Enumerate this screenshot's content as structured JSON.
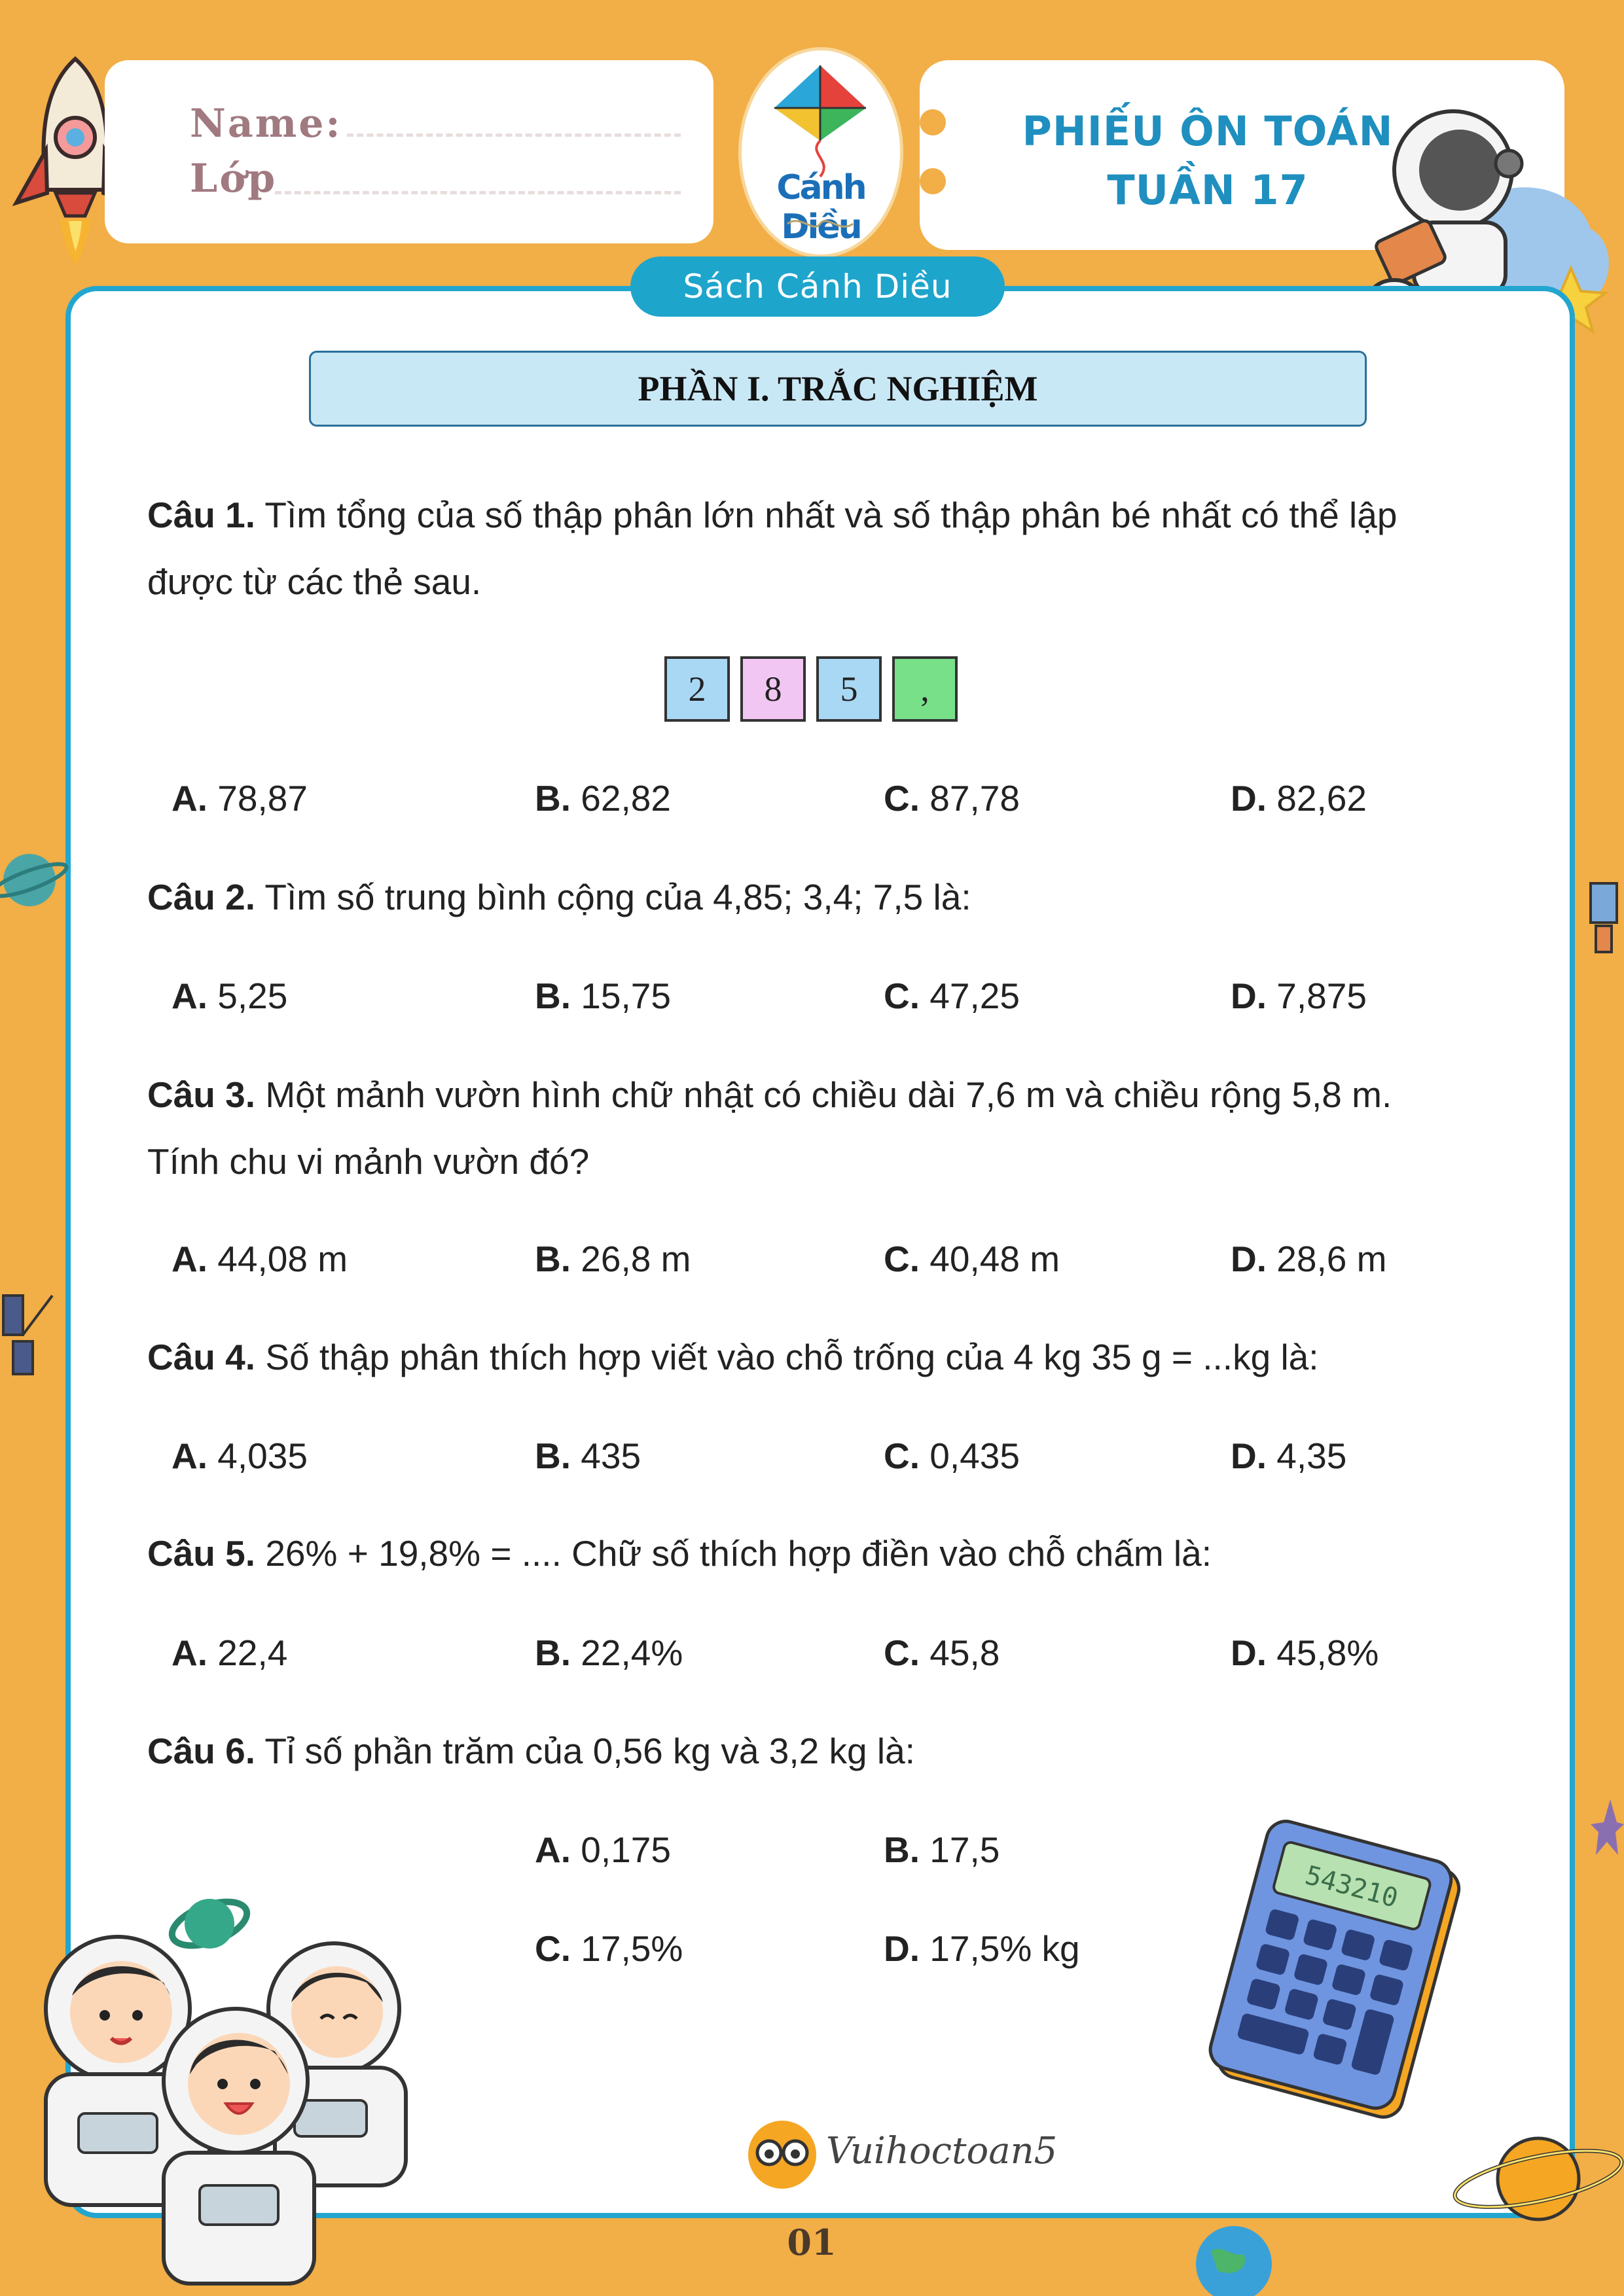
{
  "header": {
    "name_label": "Name:",
    "class_label": "Lớp",
    "title_line1": "PHIẾU ÔN TOÁN",
    "title_line2": "TUẦN 17",
    "kite_brand": "Cánh Diều",
    "book_pill": "Sách Cánh Diều"
  },
  "section": {
    "heading": "PHẦN I. TRẮC NGHIỆM"
  },
  "questions": [
    {
      "label": "Câu 1.",
      "text_line1": " Tìm tổng của số thập phân lớn nhất và số thập phân bé nhất có thể lập",
      "text_line2": "được từ các thẻ sau.",
      "cards": [
        "2",
        "8",
        "5",
        ","
      ],
      "options": [
        {
          "letter": "A.",
          "text": " 78,87"
        },
        {
          "letter": "B.",
          "text": " 62,82"
        },
        {
          "letter": "C.",
          "text": " 87,78"
        },
        {
          "letter": "D.",
          "text": " 82,62"
        }
      ]
    },
    {
      "label": "Câu 2.",
      "text_line1": " Tìm số trung bình cộng của 4,85; 3,4; 7,5 là:",
      "options": [
        {
          "letter": "A.",
          "text": " 5,25"
        },
        {
          "letter": "B.",
          "text": " 15,75"
        },
        {
          "letter": "C.",
          "text": " 47,25"
        },
        {
          "letter": "D.",
          "text": " 7,875"
        }
      ]
    },
    {
      "label": "Câu 3.",
      "text_line1": " Một mảnh vườn hình chữ nhật có chiều dài 7,6 m và chiều rộng 5,8 m.",
      "text_line2": "Tính chu vi mảnh vườn đó?",
      "options": [
        {
          "letter": "A.",
          "text": " 44,08 m"
        },
        {
          "letter": "B.",
          "text": " 26,8 m"
        },
        {
          "letter": "C.",
          "text": " 40,48 m"
        },
        {
          "letter": "D.",
          "text": " 28,6 m"
        }
      ]
    },
    {
      "label": "Câu 4.",
      "text_line1": " Số thập phân thích hợp viết vào chỗ trống của 4 kg 35 g = ...kg là:",
      "options": [
        {
          "letter": "A.",
          "text": " 4,035"
        },
        {
          "letter": "B.",
          "text": " 435"
        },
        {
          "letter": "C.",
          "text": " 0,435"
        },
        {
          "letter": "D.",
          "text": " 4,35"
        }
      ]
    },
    {
      "label": "Câu 5.",
      "text_line1": " 26% + 19,8% = .... Chữ số thích hợp điền vào chỗ chấm là:",
      "options": [
        {
          "letter": "A.",
          "text": " 22,4"
        },
        {
          "letter": "B.",
          "text": " 22,4%"
        },
        {
          "letter": "C.",
          "text": " 45,8"
        },
        {
          "letter": "D.",
          "text": " 45,8%"
        }
      ]
    },
    {
      "label": "Câu 6.",
      "text_line1": " Tỉ số phần trăm của 0,56 kg và 3,2 kg là:",
      "options": [
        {
          "letter": "A.",
          "text": " 0,175"
        },
        {
          "letter": "B.",
          "text": " 17,5"
        },
        {
          "letter": "C.",
          "text": " 17,5%"
        },
        {
          "letter": "D.",
          "text": " 17,5% kg"
        }
      ]
    }
  ],
  "calculator_display": "543210",
  "footer": {
    "brand": "Vuihoctoan5",
    "page_number": "01"
  },
  "colors": {
    "background": "#F2AE47",
    "accent_blue": "#22a6cf",
    "title_blue": "#1f8fbf",
    "section_fill": "#c9e8f6",
    "card_blue": "#a9d8f5",
    "card_pink": "#f2c6f2",
    "card_green": "#79e08a"
  }
}
